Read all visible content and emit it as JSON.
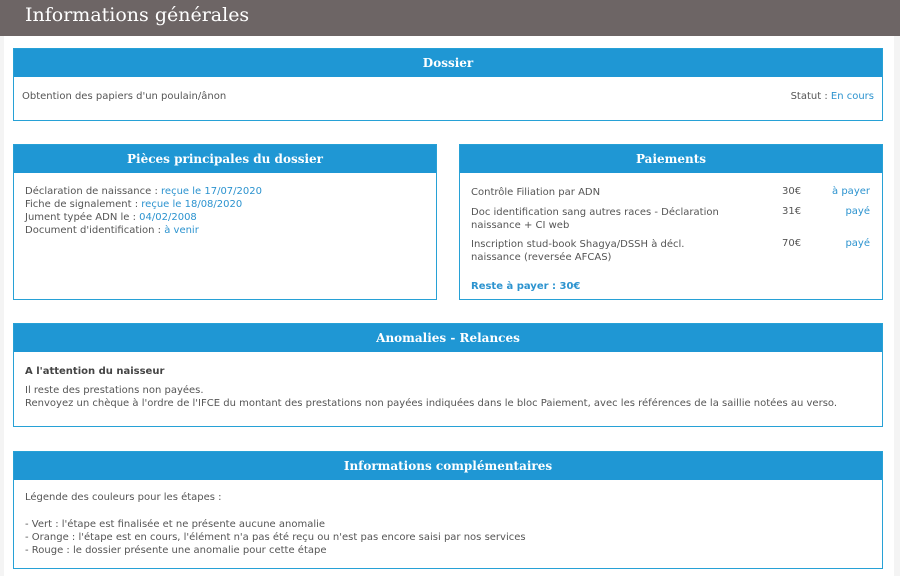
{
  "header": {
    "title": "Informations générales"
  },
  "dossier": {
    "title": "Dossier",
    "description": "Obtention des papiers d'un poulain/ânon",
    "statut_label": "Statut :",
    "statut_value": "En cours"
  },
  "pieces": {
    "title": "Pièces principales du dossier",
    "items": [
      {
        "label": "Déclaration de naissance :",
        "value": "reçue le 17/07/2020"
      },
      {
        "label": "Fiche de signalement :",
        "value": "reçue le 18/08/2020"
      },
      {
        "label": "Jument typée ADN le :",
        "value": "04/02/2008"
      },
      {
        "label": "Document d'identification :",
        "value": "à venir"
      }
    ]
  },
  "paiements": {
    "title": "Paiements",
    "items": [
      {
        "label": "Contrôle Filiation par ADN",
        "amount": "30€",
        "status": "à payer"
      },
      {
        "label": "Doc identification sang autres races - Déclaration naissance + CI web",
        "amount": "31€",
        "status": "payé"
      },
      {
        "label": "Inscription stud-book Shagya/DSSH à décl. naissance (reversée AFCAS)",
        "amount": "70€",
        "status": "payé"
      }
    ],
    "reste": "Reste à payer : 30€"
  },
  "anomalies": {
    "title": "Anomalies - Relances",
    "heading": "A l'attention du naisseur",
    "line1": "Il reste des prestations non payées.",
    "line2": "Renvoyez un chèque à l'ordre de l'IFCE du montant des prestations non payées indiquées dans le bloc Paiement, avec les références de la saillie notées au verso."
  },
  "infos": {
    "title": "Informations complémentaires",
    "legend_title": "Légende des couleurs pour les étapes :",
    "lines": [
      "- Vert : l'étape est finalisée et ne présente aucune anomalie",
      "- Orange : l'étape est en cours, l'élément n'a pas été reçu ou n'est pas encore saisi par nos services",
      "- Rouge : le dossier présente une anomalie pour cette étape"
    ]
  }
}
